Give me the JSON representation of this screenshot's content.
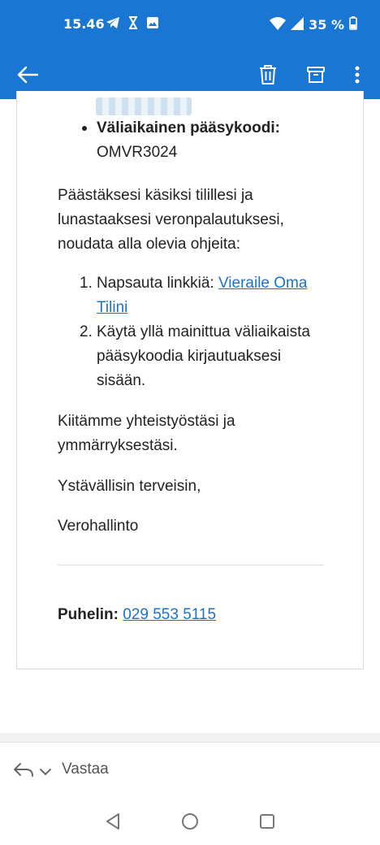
{
  "status_bar": {
    "time": "15.46",
    "battery": "35 %",
    "icons": [
      "telegram-icon",
      "hourglass-icon",
      "image-icon",
      "wifi-icon",
      "signal-icon",
      "battery-icon"
    ]
  },
  "app_bar": {
    "icons": [
      "back-arrow-icon",
      "trash-icon",
      "archive-icon",
      "more-vert-icon"
    ],
    "color": "#1976d2"
  },
  "email": {
    "bullet_label": "Väliaikainen pääsykoodi:",
    "access_code": "OMVR3024",
    "intro_line1": "Päästäksesi käsiksi tilillesi ja",
    "intro_line2": "lunastaaksesi veronpalautuksesi,",
    "intro_line3": "noudata alla olevia ohjeita:",
    "step1_number": "1.",
    "step1_text": "Napsauta linkkiä: ",
    "step1_link_line1": "Vieraile Oma",
    "step1_link_line2": "Tilini",
    "step2_number": "2.",
    "step2_line1": "Käytä yllä mainittua väliaikaista",
    "step2_line2": "pääsykoodia kirjautuaksesi",
    "step2_line3": "sisään.",
    "thanks_line1": "Kiitämme yhteistyöstäsi ja",
    "thanks_line2": "ymmärryksestäsi.",
    "regards": "Ystävällisin terveisin,",
    "sender": "Verohallinto",
    "phone_label": "Puhelin:",
    "phone_number": "029 553 5115",
    "link_color": "#1a73c8"
  },
  "reply_bar": {
    "label": "Vastaa",
    "icons": [
      "reply-icon",
      "chevron-down-icon"
    ]
  },
  "nav_bar": {
    "icons": [
      "nav-back-icon",
      "nav-home-icon",
      "nav-recents-icon"
    ]
  }
}
